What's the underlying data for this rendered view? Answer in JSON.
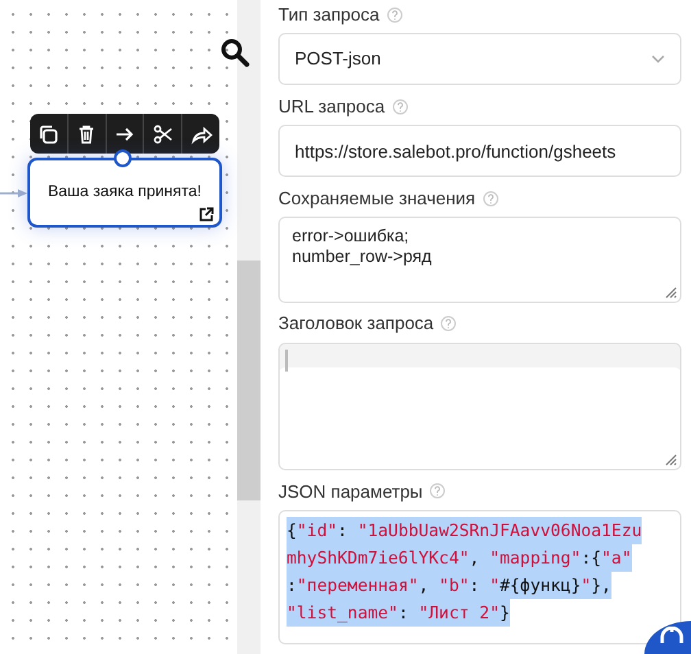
{
  "canvas": {
    "node": {
      "text": "Ваша заяка принята!"
    },
    "toolbar": [
      {
        "kind": "copy"
      },
      {
        "kind": "delete"
      },
      {
        "kind": "arrow"
      },
      {
        "kind": "cut"
      },
      {
        "kind": "share"
      }
    ]
  },
  "panel": {
    "fields": [
      {
        "kind": "select",
        "label": "Тип запроса",
        "value": "POST-json"
      },
      {
        "kind": "input",
        "label": "URL запроса",
        "value": "https://store.salebot.pro/function/gsheets"
      },
      {
        "kind": "textarea",
        "label": "Сохраняемые значения",
        "lines": [
          "error->ошибка;",
          "number_row->ряд"
        ]
      },
      {
        "kind": "textarea",
        "label": "Заголовок запроса",
        "focused": true
      },
      {
        "kind": "code",
        "label": "JSON параметры",
        "selected": true,
        "code_lines": [
          [
            {
              "t": "{",
              "kind": "punct"
            },
            {
              "t": "\"id\"",
              "kind": "string"
            },
            {
              "t": ": ",
              "kind": "punct"
            },
            {
              "t": "\"1aUbbUaw2SRnJFAavv06Noa1Ezu",
              "kind": "string"
            }
          ],
          [
            {
              "t": "mhyShKDm7ie6lYKc4\"",
              "kind": "string"
            },
            {
              "t": ", ",
              "kind": "punct"
            },
            {
              "t": "\"mapping\"",
              "kind": "string"
            },
            {
              "t": ":{",
              "kind": "punct"
            },
            {
              "t": "\"a\"",
              "kind": "string"
            }
          ],
          [
            {
              "t": ":",
              "kind": "punct"
            },
            {
              "t": "\"переменная\"",
              "kind": "string"
            },
            {
              "t": ", ",
              "kind": "punct"
            },
            {
              "t": "\"b\"",
              "kind": "string"
            },
            {
              "t": ": ",
              "kind": "punct"
            },
            {
              "t": "\"",
              "kind": "string"
            },
            {
              "t": "#{функц}",
              "kind": "punct"
            },
            {
              "t": "\"",
              "kind": "string"
            },
            {
              "t": "},",
              "kind": "punct"
            }
          ],
          [
            {
              "t": "\"list_name\"",
              "kind": "string"
            },
            {
              "t": ": ",
              "kind": "punct"
            },
            {
              "t": "\"Лист 2\"",
              "kind": "string"
            },
            {
              "t": "}",
              "kind": "punct"
            }
          ]
        ]
      }
    ]
  }
}
